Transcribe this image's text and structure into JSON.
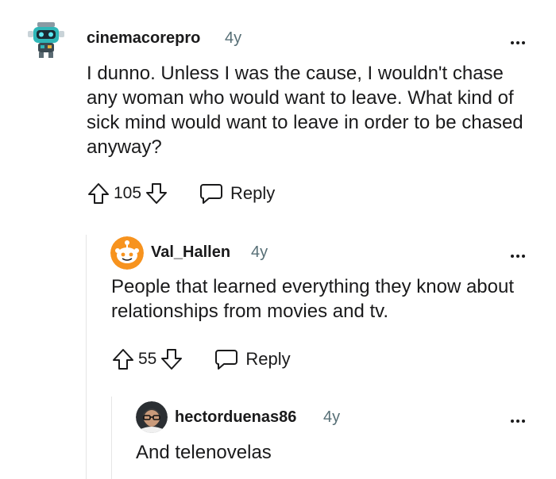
{
  "comments": [
    {
      "username": "cinemacorepro",
      "age": "4y",
      "body": "I dunno. Unless I was the cause, I wouldn't chase any woman who would want to leave. What kind of sick mind would want to leave in order to be chased anyway?",
      "votes": "105",
      "reply_label": "Reply",
      "avatar_icon": "robot-avatar-icon"
    },
    {
      "username": "Val_Hallen",
      "age": "4y",
      "body": "People that learned everything they know about relationships from movies and tv.",
      "votes": "55",
      "reply_label": "Reply",
      "avatar_icon": "snoo-avatar-icon"
    },
    {
      "username": "hectorduenas86",
      "age": "4y",
      "body": "And telenovelas",
      "avatar_icon": "bearded-avatar-icon"
    }
  ],
  "colors": {
    "muted": "#576f76",
    "thread_line": "#e5e5e5",
    "robot_teal": "#2fb7b8",
    "snoo_orange": "#f7931e"
  }
}
